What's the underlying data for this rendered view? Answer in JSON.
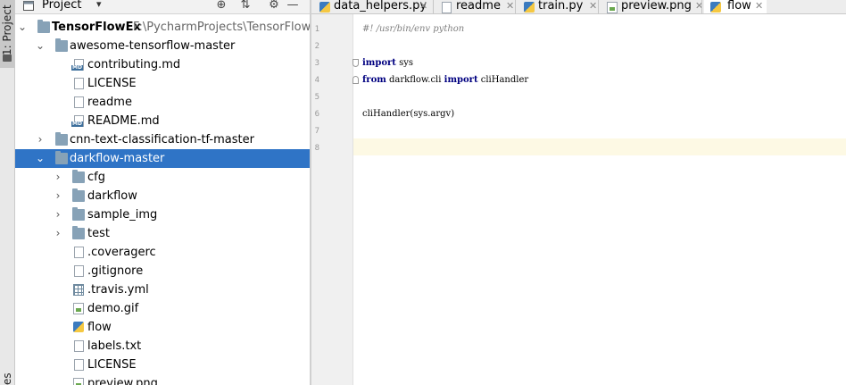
{
  "side_strip": {
    "project_label": "1: Project",
    "bottom_label": "es"
  },
  "project_panel": {
    "title": "Project",
    "toolbar_icons": [
      "target-icon",
      "collapse-all-icon",
      "gear-icon",
      "minimize-icon"
    ]
  },
  "tree": [
    {
      "name": "TensorFlowEx",
      "path": "F:\\PycharmProjects\\TensorFlowEx",
      "type": "folder",
      "expanded": true
    },
    {
      "name": "awesome-tensorflow-master",
      "type": "folder",
      "expanded": true
    },
    {
      "name": "contributing.md",
      "type": "md"
    },
    {
      "name": "LICENSE",
      "type": "file"
    },
    {
      "name": "readme",
      "type": "file"
    },
    {
      "name": "README.md",
      "type": "md"
    },
    {
      "name": "cnn-text-classification-tf-master",
      "type": "folder",
      "expanded": false
    },
    {
      "name": "darkflow-master",
      "type": "folder",
      "expanded": true,
      "selected": true
    },
    {
      "name": "cfg",
      "type": "folder",
      "expanded": false
    },
    {
      "name": "darkflow",
      "type": "folder",
      "expanded": false
    },
    {
      "name": "sample_img",
      "type": "folder",
      "expanded": false
    },
    {
      "name": "test",
      "type": "folder",
      "expanded": false
    },
    {
      "name": ".coveragerc",
      "type": "file"
    },
    {
      "name": ".gitignore",
      "type": "file"
    },
    {
      "name": ".travis.yml",
      "type": "yml"
    },
    {
      "name": "demo.gif",
      "type": "image"
    },
    {
      "name": "flow",
      "type": "python"
    },
    {
      "name": "labels.txt",
      "type": "file"
    },
    {
      "name": "LICENSE",
      "type": "file"
    },
    {
      "name": "preview.png",
      "type": "image"
    }
  ],
  "tabs": [
    {
      "label": "data_helpers.py",
      "icon": "python-file-icon",
      "active": false
    },
    {
      "label": "readme",
      "icon": "text-file-icon",
      "active": false
    },
    {
      "label": "train.py",
      "icon": "python-file-icon",
      "active": false
    },
    {
      "label": "preview.png",
      "icon": "image-file-icon",
      "active": false
    },
    {
      "label": "flow",
      "icon": "python-file-icon",
      "active": true
    }
  ],
  "editor": {
    "line_numbers": [
      "1",
      "2",
      "3",
      "4",
      "5",
      "6",
      "7",
      "8"
    ],
    "lines": {
      "l1_comment": "#! /usr/bin/env python",
      "l3_kw": "import",
      "l3_rest": " sys",
      "l4_kw1": "from",
      "l4_mid": " darkflow.cli ",
      "l4_kw2": "import",
      "l4_rest": " cliHandler",
      "l6": "cliHandler(sys.argv)"
    },
    "current_line": 8
  },
  "colors": {
    "selection": "#2f74c6",
    "keyword": "#000080",
    "comment": "#808080",
    "current_line": "#fdf9e4"
  }
}
